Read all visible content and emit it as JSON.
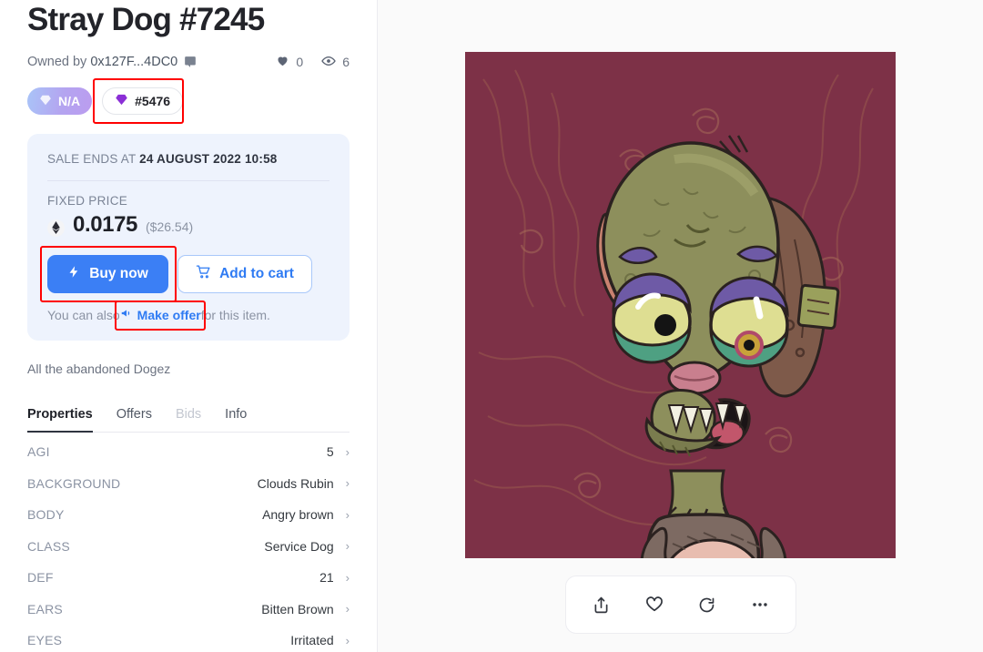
{
  "item": {
    "title": "Stray Dog #7245",
    "owned_by_label": "Owned by",
    "owner_address": "0x127F...4DC0",
    "chat_icon": "chat-bubble-icon",
    "likes_count": "0",
    "views_count": "6",
    "heart_icon": "heart-filled-icon",
    "eye_icon": "eye-icon"
  },
  "badges": {
    "rank_label": "N/A",
    "rank_icon": "diamond-icon",
    "id_label": "#5476",
    "id_icon": "diamond-icon"
  },
  "sale": {
    "ends_prefix": "SALE ENDS AT ",
    "ends_at": "24 AUGUST 2022 10:58",
    "price_type_label": "FIXED PRICE",
    "currency_icon": "ethereum-icon",
    "price": "0.0175",
    "price_usd": "($26.54)",
    "buy_now_label": "Buy now",
    "buy_now_icon": "lightning-bolt-icon",
    "add_to_cart_label": "Add to cart",
    "cart_icon": "shopping-cart-icon",
    "offer_prefix": "You can also ",
    "offer_link_label": "Make offer",
    "offer_icon": "megaphone-icon",
    "offer_suffix": " for this item."
  },
  "collection": {
    "description": "All the abandoned Dogez"
  },
  "tabs": [
    {
      "label": "Properties",
      "state": "active"
    },
    {
      "label": "Offers",
      "state": "enabled"
    },
    {
      "label": "Bids",
      "state": "disabled"
    },
    {
      "label": "Info",
      "state": "enabled"
    }
  ],
  "properties": [
    {
      "key": "AGI",
      "value": "5"
    },
    {
      "key": "BACKGROUND",
      "value": "Clouds Rubin"
    },
    {
      "key": "BODY",
      "value": "Angry brown"
    },
    {
      "key": "CLASS",
      "value": "Service Dog"
    },
    {
      "key": "DEF",
      "value": "21"
    },
    {
      "key": "EARS",
      "value": "Bitten Brown"
    },
    {
      "key": "EYES",
      "value": "Irritated"
    }
  ],
  "artwork": {
    "alt": "Stray Dog #7245 zombie dog illustration on maroon background",
    "background_color": "#7d3147",
    "body_color": "#8d8f5c"
  },
  "action_bar": {
    "share_icon": "share-upload-icon",
    "favorite_icon": "heart-outline-icon",
    "refresh_icon": "refresh-rotate-icon",
    "more_icon": "more-horizontal-icon"
  },
  "colors": {
    "accent_blue": "#3b7ff5",
    "panel_blue": "#eef3fd",
    "highlight_red": "#ff0000",
    "text_dark": "#23242a",
    "text_muted": "#8b93a3"
  }
}
